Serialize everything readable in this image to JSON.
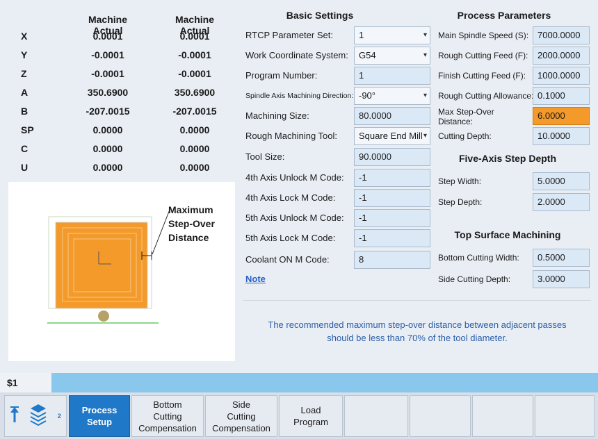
{
  "axes": {
    "headers": [
      "Machine Actual",
      "Machine Actual"
    ],
    "rows": [
      {
        "label": "X",
        "v1": "0.0001",
        "v2": "0.0001"
      },
      {
        "label": "Y",
        "v1": "-0.0001",
        "v2": "-0.0001"
      },
      {
        "label": "Z",
        "v1": "-0.0001",
        "v2": "-0.0001"
      },
      {
        "label": "A",
        "v1": "350.6900",
        "v2": "350.6900"
      },
      {
        "label": "B",
        "v1": "-207.0015",
        "v2": "-207.0015"
      },
      {
        "label": "SP",
        "v1": "0.0000",
        "v2": "0.0000"
      },
      {
        "label": "C",
        "v1": "0.0000",
        "v2": "0.0000"
      },
      {
        "label": "U",
        "v1": "0.0000",
        "v2": "0.0000"
      }
    ]
  },
  "diagram": {
    "callout_lines": [
      "Maximum",
      "Step-Over",
      "Distance"
    ],
    "colors": {
      "part": "#f39a2a",
      "line": "#8fd88a",
      "tool": "#b5a26a"
    }
  },
  "basic": {
    "title": "Basic Settings",
    "rows": [
      {
        "label": "RTCP Parameter Set:",
        "value": "1",
        "type": "select"
      },
      {
        "label": "Work Coordinate System:",
        "value": "G54",
        "type": "select"
      },
      {
        "label": "Program Number:",
        "value": "1",
        "type": "input"
      },
      {
        "label": "Spindle Axis Machining Direction:",
        "value": "-90°",
        "type": "select"
      },
      {
        "label": "Machining Size:",
        "value": "80.0000",
        "type": "input"
      },
      {
        "label": "Rough Machining Tool:",
        "value": "Square End Mill",
        "type": "select"
      },
      {
        "label": "Tool Size:",
        "value": "90.0000",
        "type": "input"
      },
      {
        "label": "4th Axis Unlock M Code:",
        "value": "-1",
        "type": "input"
      },
      {
        "label": "4th Axis Lock M Code:",
        "value": "-1",
        "type": "input"
      },
      {
        "label": "5th Axis Unlock M Code:",
        "value": "-1",
        "type": "input"
      },
      {
        "label": "5th Axis Lock M Code:",
        "value": "-1",
        "type": "input"
      },
      {
        "label": "Coolant ON M Code:",
        "value": "8",
        "type": "input"
      }
    ],
    "note_label": "Note"
  },
  "process": {
    "title": "Process Parameters",
    "rows": [
      {
        "label": "Main Spindle Speed (S):",
        "value": "7000.0000"
      },
      {
        "label": "Rough Cutting Feed (F):",
        "value": "2000.0000"
      },
      {
        "label": "Finish Cutting Feed (F):",
        "value": "1000.0000"
      },
      {
        "label": "Rough Cutting Allowance:",
        "value": "0.1000"
      },
      {
        "label_line1": "Max Step-Over",
        "label_line2": "Distance:",
        "value": "6.0000"
      },
      {
        "label": "Cutting Depth:",
        "value": "10.0000"
      }
    ]
  },
  "five_axis": {
    "title": "Five-Axis Step Depth",
    "rows": [
      {
        "label": "Step Width:",
        "value": "5.0000"
      },
      {
        "label": "Step Depth:",
        "value": "2.0000"
      }
    ]
  },
  "top_surface": {
    "title": "Top Surface Machining",
    "rows": [
      {
        "label": "Bottom Cutting Width:",
        "value": "0.5000"
      },
      {
        "label": "Side Cutting Depth:",
        "value": "3.0000"
      }
    ]
  },
  "message": {
    "line1": "The recommended maximum step-over distance between adjacent passes",
    "line2": "should be less than 70% of the tool diameter."
  },
  "status": {
    "prompt": "$1"
  },
  "softkeys": {
    "layer_badge": "2",
    "process_setup": [
      "Process",
      "Setup"
    ],
    "bottom_comp": [
      "Bottom",
      "Cutting",
      "Compensation"
    ],
    "side_comp": [
      "Side",
      "Cutting",
      "Compensation"
    ],
    "load_program": [
      "Load",
      "Program"
    ]
  },
  "icons": [
    "up-arrow-icon",
    "layers-icon"
  ]
}
